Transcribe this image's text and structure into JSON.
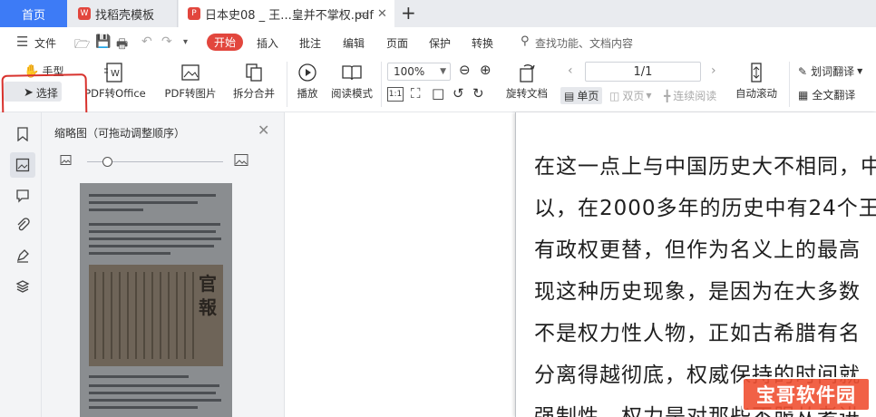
{
  "tabs": {
    "home": "首页",
    "template": "找稻壳模板",
    "document": "日本史08 _ 王...皇并不掌权.pdf"
  },
  "menu": {
    "file": "文件",
    "start": "开始",
    "insert": "插入",
    "annotate": "批注",
    "edit": "编辑",
    "page": "页面",
    "protect": "保护",
    "convert": "转换",
    "search_placeholder": "查找功能、文档内容"
  },
  "toolbar": {
    "hand": "手型",
    "select": "选择",
    "pdf_to_office": "PDF转Office",
    "pdf_to_image": "PDF转图片",
    "split_merge": "拆分合并",
    "play": "播放",
    "read_mode": "阅读模式",
    "zoom": "100%",
    "rotate": "旋转文档",
    "page_indicator": "1/1",
    "single_page": "单页",
    "double_page": "双页",
    "continuous": "连续阅读",
    "auto_scroll": "自动滚动",
    "word_translate": "划词翻译",
    "full_translate": "全文翻译",
    "actual_size": "1:1"
  },
  "thumbnail_panel": {
    "title": "缩略图（可拖动调整顺序）",
    "thumb_seal": "官報"
  },
  "document": {
    "lines": [
      "在这一点上与中国历史大不相同，中",
      "以，在2000多年的历史中有24个王",
      "有政权更替，但作为名义上的最高",
      "现这种历史现象，是因为在大多数",
      "不是权力性人物，正如古希腊有名",
      "分离得越彻底，权威保持的时间就",
      "强制性，权力是对那些不服从者进"
    ]
  },
  "watermark": "宝哥软件园",
  "colors": {
    "accent_blue": "#3d7bf6",
    "start_red": "#e2463d",
    "annotation_red": "#d8322d"
  }
}
